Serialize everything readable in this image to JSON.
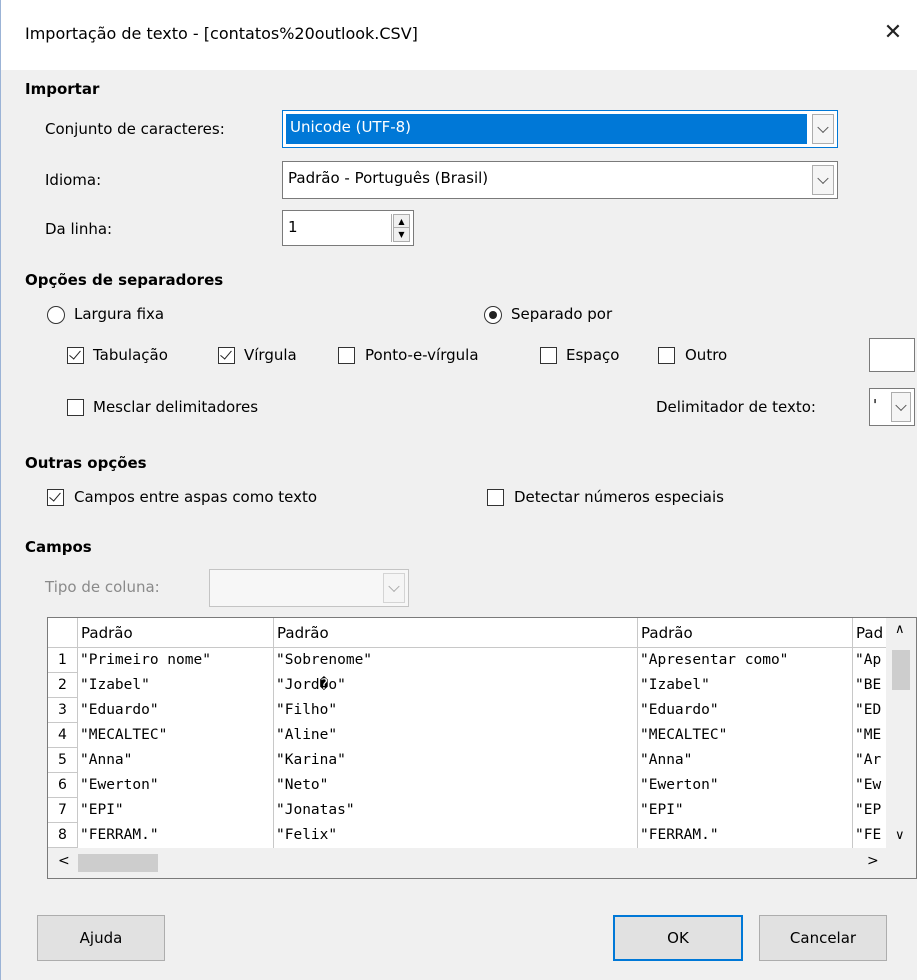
{
  "window": {
    "title": "Importação de texto - [contatos%20outlook.CSV]",
    "close_glyph": "✕"
  },
  "import": {
    "heading": "Importar",
    "charset_label": "Conjunto de caracteres:",
    "charset_value": "Unicode (UTF-8)",
    "language_label": "Idioma:",
    "language_value": "Padrão - Português (Brasil)",
    "from_row_label": "Da linha:",
    "from_row_value": "1"
  },
  "separators": {
    "heading": "Opções de separadores",
    "fixed_width": "Largura fixa",
    "separated_by": "Separado por",
    "tab": "Tabulação",
    "comma": "Vírgula",
    "semicolon": "Ponto-e-vírgula",
    "space": "Espaço",
    "other": "Outro",
    "merge": "Mesclar delimitadores",
    "text_delim_label": "Delimitador de texto:",
    "text_delim_value": "'"
  },
  "other_options": {
    "heading": "Outras opções",
    "quoted_as_text": "Campos entre aspas como texto",
    "detect_special": "Detectar números especiais"
  },
  "fields": {
    "heading": "Campos",
    "column_type_label": "Tipo de coluna:",
    "headers": [
      "Padrão",
      "Padrão",
      "Padrão",
      "Pad"
    ],
    "rows": [
      {
        "n": "1",
        "c": [
          "\"Primeiro nome\"",
          "\"Sobrenome\"",
          "\"Apresentar como\"",
          "\"Ap"
        ]
      },
      {
        "n": "2",
        "c": [
          "\"Izabel\"",
          "\"Jord�o\"",
          "\"Izabel\"",
          "\"BE"
        ]
      },
      {
        "n": "3",
        "c": [
          "\"Eduardo\"",
          "\"Filho\"",
          "\"Eduardo\"",
          "\"ED"
        ]
      },
      {
        "n": "4",
        "c": [
          "\"MECALTEC\"",
          "\"Aline\"",
          "\"MECALTEC\"",
          "\"ME"
        ]
      },
      {
        "n": "5",
        "c": [
          "\"Anna\"",
          "\"Karina\"",
          "\"Anna\"",
          "\"Ar"
        ]
      },
      {
        "n": "6",
        "c": [
          "\"Ewerton\"",
          "\"Neto\"",
          "\"Ewerton\"",
          "\"Ew"
        ]
      },
      {
        "n": "7",
        "c": [
          "\"EPI\"",
          "\"Jonatas\"",
          "\"EPI\"",
          "\"EP"
        ]
      },
      {
        "n": "8",
        "c": [
          "\"FERRAM.\"",
          "\"Felix\"",
          "\"FERRAM.\"",
          "\"FE"
        ]
      }
    ]
  },
  "buttons": {
    "help": "Ajuda",
    "ok": "OK",
    "cancel": "Cancelar"
  },
  "colors": {
    "selection": "#0078d7",
    "accent": "#0078d7"
  }
}
